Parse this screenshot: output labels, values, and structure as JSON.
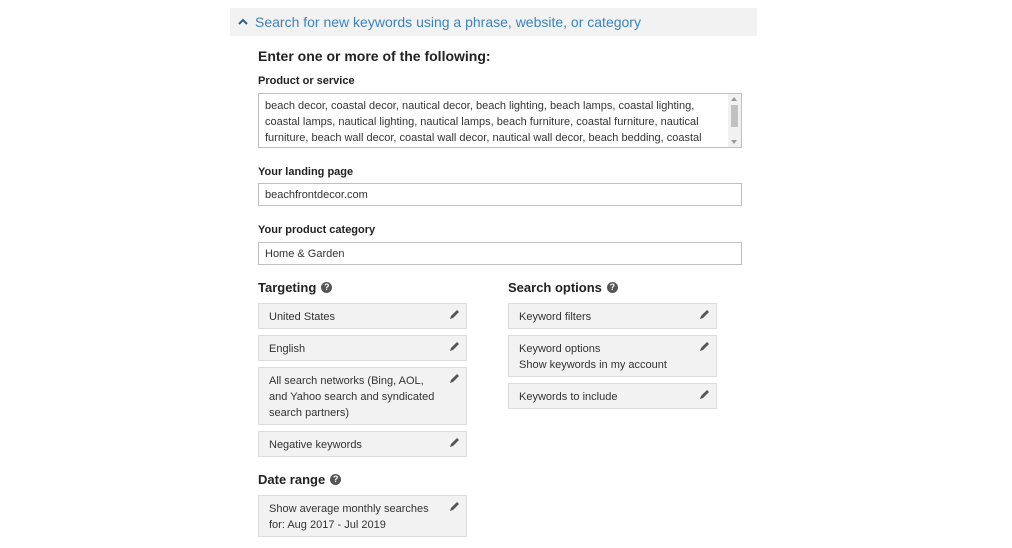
{
  "header": {
    "title": "Search for new keywords using a phrase, website, or category"
  },
  "form": {
    "heading": "Enter one or more of the following:",
    "product_label": "Product or service",
    "product_value": "beach decor, coastal decor, nautical decor, beach lighting, beach lamps, coastal lighting, coastal lamps, nautical lighting, nautical lamps, beach furniture, coastal furniture, nautical furniture, beach wall decor, coastal wall decor, nautical wall decor, beach bedding, coastal",
    "landing_label": "Your landing page",
    "landing_value": "beachfrontdecor.com",
    "category_label": "Your product category",
    "category_value": "Home & Garden"
  },
  "targeting": {
    "title": "Targeting",
    "items": [
      "United States",
      "English",
      "All search networks (Bing, AOL, and Yahoo search and syndicated search partners)",
      "Negative keywords"
    ]
  },
  "date_range": {
    "title": "Date range",
    "value": "Show average monthly searches for: Aug 2017 - Jul 2019"
  },
  "search_options": {
    "title": "Search options",
    "items": [
      {
        "label": "Keyword filters",
        "sub": ""
      },
      {
        "label": "Keyword options",
        "sub": "Show keywords in my account"
      },
      {
        "label": "Keywords to include",
        "sub": ""
      }
    ]
  },
  "icons": {
    "collapse": "chevron-up-icon",
    "help": "question-circle-icon",
    "edit": "pencil-icon"
  },
  "colors": {
    "link_blue": "#3c83c0",
    "panel_gray": "#f2f2f2"
  }
}
